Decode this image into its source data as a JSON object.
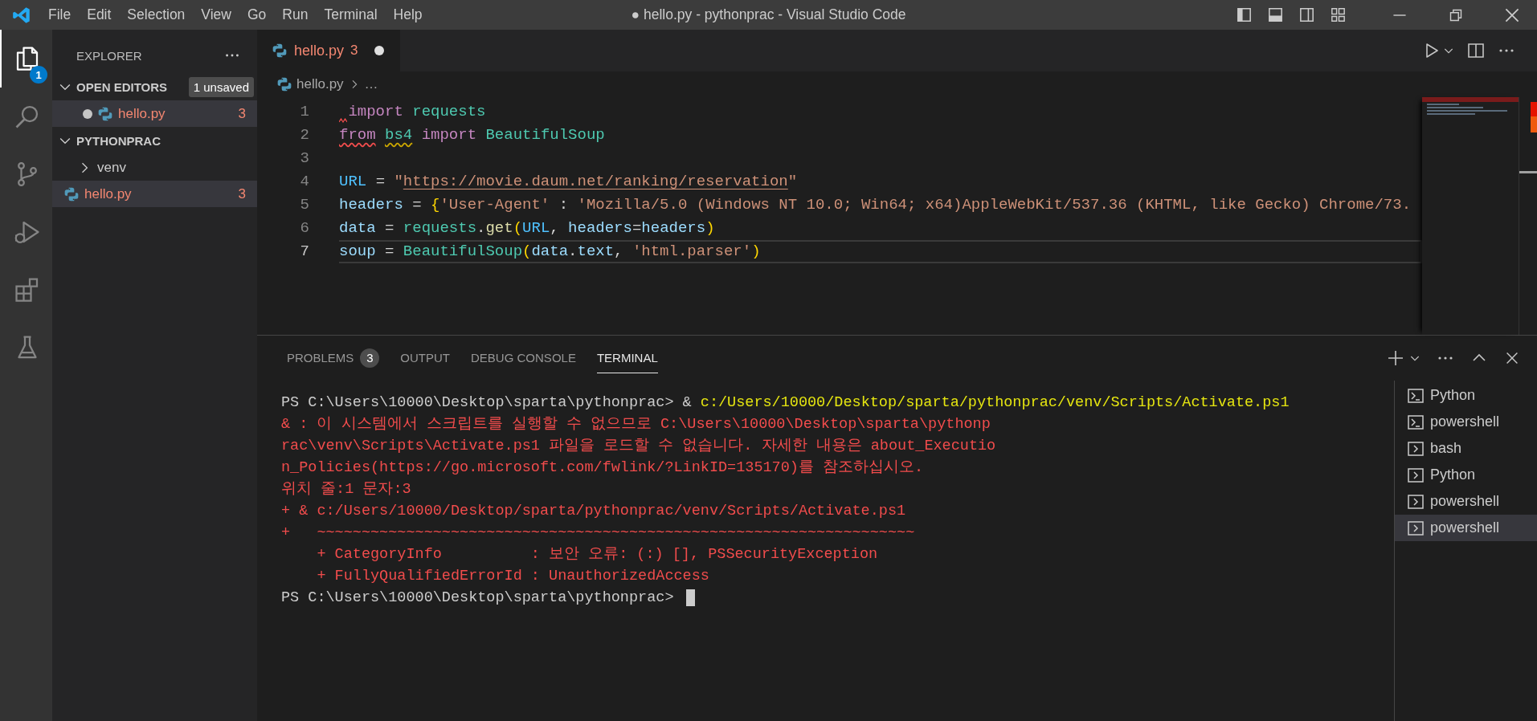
{
  "title_bar": {
    "menu": [
      "File",
      "Edit",
      "Selection",
      "View",
      "Go",
      "Run",
      "Terminal",
      "Help"
    ],
    "title": "● hello.py - pythonprac - Visual Studio Code"
  },
  "activity_bar": {
    "items": [
      {
        "kind": "explorer",
        "selected": true,
        "badge": "1"
      },
      {
        "kind": "search",
        "selected": false
      },
      {
        "kind": "source-control",
        "selected": false
      },
      {
        "kind": "run-debug",
        "selected": false
      },
      {
        "kind": "extensions",
        "selected": false
      },
      {
        "kind": "testing",
        "selected": false
      }
    ]
  },
  "sidebar": {
    "title": "EXPLORER",
    "sections": [
      {
        "title": "OPEN EDITORS",
        "expanded": true,
        "badge": "1 unsaved",
        "items": [
          {
            "kind": "python",
            "name": "hello.py",
            "problems": "3",
            "dirty": true,
            "selected": true
          }
        ]
      },
      {
        "title": "PYTHONPRAC",
        "expanded": true,
        "items": [
          {
            "kind": "folder",
            "name": "venv",
            "expanded": false,
            "selected": false
          },
          {
            "kind": "python",
            "name": "hello.py",
            "problems": "3",
            "selected": true
          }
        ]
      }
    ]
  },
  "editor": {
    "tabs": [
      {
        "name": "hello.py",
        "problems": "3",
        "dirty": true,
        "selected": true
      }
    ],
    "breadcrumb": [
      "hello.py",
      "…"
    ],
    "lines": [
      {
        "number": "1",
        "current": false,
        "error_marker": true,
        "tokens": [
          {
            "text": " import",
            "kind": "keyword"
          },
          {
            "text": " requests",
            "kind": "module"
          }
        ]
      },
      {
        "number": "2",
        "current": false,
        "tokens": [
          {
            "text": "from",
            "kind": "keyword",
            "error": true
          },
          {
            "text": " bs4",
            "kind": "module",
            "warning": true
          },
          {
            "text": " import",
            "kind": "keyword"
          },
          {
            "text": " BeautifulSoup",
            "kind": "module"
          }
        ]
      },
      {
        "number": "3",
        "current": false
      },
      {
        "number": "4",
        "current": false,
        "tokens": [
          {
            "text": "URL",
            "kind": "constant"
          },
          {
            "text": " = ",
            "kind": "plain"
          },
          {
            "text": "\"",
            "kind": "string"
          },
          {
            "text": "https://movie.daum.net/ranking/reservation",
            "kind": "string",
            "underline": true
          },
          {
            "text": "\"",
            "kind": "string"
          }
        ]
      },
      {
        "number": "5",
        "current": false,
        "tokens": [
          {
            "text": "headers",
            "kind": "variable"
          },
          {
            "text": " = ",
            "kind": "plain"
          },
          {
            "text": "{",
            "kind": "bracket"
          },
          {
            "text": "'User-Agent'",
            "kind": "string"
          },
          {
            "text": " : ",
            "kind": "plain"
          },
          {
            "text": "'Mozilla/5.0 (Windows NT 10.0; Win64; x64)AppleWebKit/537.36 (KHTML, like Gecko) Chrome/73.",
            "kind": "string"
          }
        ]
      },
      {
        "number": "6",
        "current": false,
        "tokens": [
          {
            "text": "data",
            "kind": "variable"
          },
          {
            "text": " = ",
            "kind": "plain"
          },
          {
            "text": "requests",
            "kind": "module"
          },
          {
            "text": ".",
            "kind": "plain"
          },
          {
            "text": "get",
            "kind": "function"
          },
          {
            "text": "(",
            "kind": "bracket"
          },
          {
            "text": "URL",
            "kind": "constant"
          },
          {
            "text": ", ",
            "kind": "plain"
          },
          {
            "text": "headers",
            "kind": "variable"
          },
          {
            "text": "=",
            "kind": "plain"
          },
          {
            "text": "headers",
            "kind": "variable"
          },
          {
            "text": ")",
            "kind": "bracket"
          }
        ]
      },
      {
        "number": "7",
        "current": true,
        "tokens": [
          {
            "text": "soup",
            "kind": "variable"
          },
          {
            "text": " = ",
            "kind": "plain"
          },
          {
            "text": "BeautifulSoup",
            "kind": "module"
          },
          {
            "text": "(",
            "kind": "bracket"
          },
          {
            "text": "data",
            "kind": "variable"
          },
          {
            "text": ".",
            "kind": "plain"
          },
          {
            "text": "text",
            "kind": "variable"
          },
          {
            "text": ", ",
            "kind": "plain"
          },
          {
            "text": "'html.parser'",
            "kind": "string"
          },
          {
            "text": ")",
            "kind": "bracket"
          }
        ]
      }
    ]
  },
  "panel": {
    "tabs": [
      {
        "label": "PROBLEMS",
        "badge": "3",
        "selected": false
      },
      {
        "label": "OUTPUT",
        "selected": false
      },
      {
        "label": "DEBUG CONSOLE",
        "selected": false
      },
      {
        "label": "TERMINAL",
        "selected": true
      }
    ],
    "terminal_lines": [
      {
        "segments": [
          {
            "text": "PS C:\\Users\\10000\\Desktop\\sparta\\pythonprac> & ",
            "kind": "plain"
          },
          {
            "text": "c:/Users/10000/Desktop/sparta/pythonprac/venv/Scripts/Activate.ps1",
            "kind": "command"
          }
        ]
      },
      {
        "segments": [
          {
            "text": "& : 이 시스템에서 스크립트를 실행할 수 없으므로 C:\\Users\\10000\\Desktop\\sparta\\pythonp",
            "kind": "error"
          }
        ]
      },
      {
        "segments": [
          {
            "text": "rac\\venv\\Scripts\\Activate.ps1 파일을 로드할 수 없습니다. 자세한 내용은 about_Executio",
            "kind": "error"
          }
        ]
      },
      {
        "segments": [
          {
            "text": "n_Policies(https://go.microsoft.com/fwlink/?LinkID=135170)를 참조하십시오.",
            "kind": "error"
          }
        ]
      },
      {
        "segments": [
          {
            "text": "위치 줄:1 문자:3",
            "kind": "error"
          }
        ]
      },
      {
        "segments": [
          {
            "text": "+ & c:/Users/10000/Desktop/sparta/pythonprac/venv/Scripts/Activate.ps1",
            "kind": "error"
          }
        ]
      },
      {
        "segments": [
          {
            "text": "+   ~~~~~~~~~~~~~~~~~~~~~~~~~~~~~~~~~~~~~~~~~~~~~~~~~~~~~~~~~~~~~~~~~~~",
            "kind": "error"
          }
        ]
      },
      {
        "segments": [
          {
            "text": "    + CategoryInfo          : 보안 오류: (:) [], PSSecurityException",
            "kind": "error"
          }
        ]
      },
      {
        "segments": [
          {
            "text": "    + FullyQualifiedErrorId : UnauthorizedAccess",
            "kind": "error"
          }
        ]
      },
      {
        "segments": [
          {
            "text": "PS C:\\Users\\10000\\Desktop\\sparta\\pythonprac> ",
            "kind": "plain"
          }
        ],
        "cursor": true
      }
    ],
    "terminals": [
      {
        "kind": "prompt",
        "name": "Python",
        "selected": false
      },
      {
        "kind": "prompt",
        "name": "powershell",
        "selected": false
      },
      {
        "kind": "chevron",
        "name": "bash",
        "selected": false
      },
      {
        "kind": "chevron",
        "name": "Python",
        "selected": false
      },
      {
        "kind": "chevron",
        "name": "powershell",
        "selected": false
      },
      {
        "kind": "chevron",
        "name": "powershell",
        "selected": true
      }
    ]
  }
}
